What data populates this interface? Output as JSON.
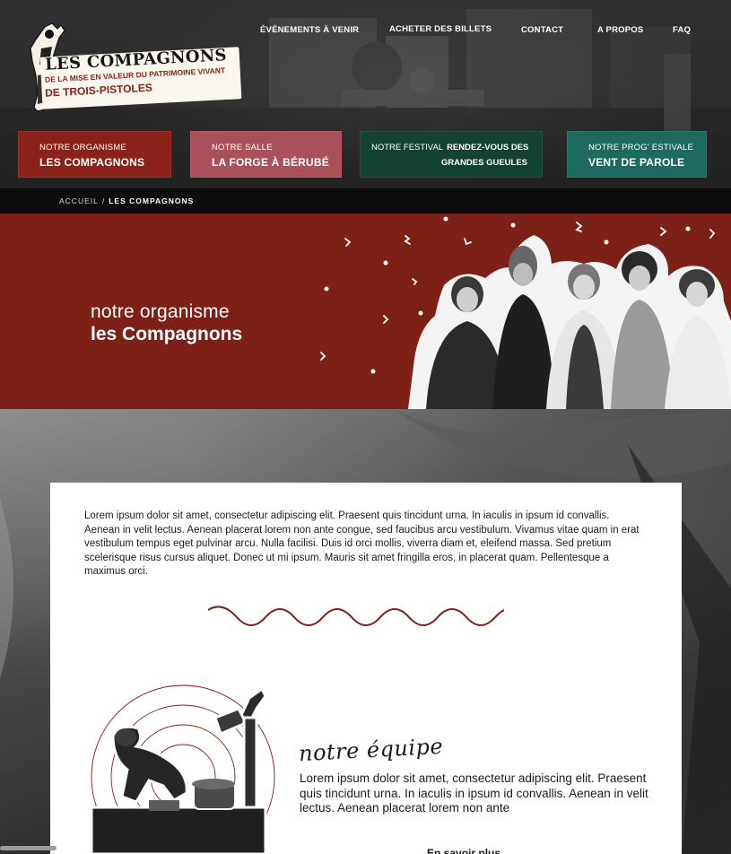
{
  "logo": {
    "line1": "LES COMPAGNONS",
    "line2": "DE LA MISE EN VALEUR DU PATRIMOINE VIVANT",
    "line3": "DE TROIS-PISTOLES"
  },
  "nav": [
    {
      "label": "ÉVÉNEMENTS À VENIR"
    },
    {
      "label": "ACHETER DES BILLETS"
    },
    {
      "label": "CONTACT"
    },
    {
      "label": "A PROPOS"
    },
    {
      "label": "FAQ"
    }
  ],
  "tiles": [
    {
      "small": "NOTRE ORGANISME",
      "big": "LES COMPAGNONS",
      "color": "#8b2219"
    },
    {
      "small": "NOTRE SALLE",
      "big": "LA FORGE À BÉRUBÉ",
      "color": "#a9505a"
    },
    {
      "small": "NOTRE FESTIVAL",
      "big": "RENDEZ-VOUS DES",
      "big2": "GRANDES GUEULES",
      "color": "#134133"
    },
    {
      "small": "NOTRE PROG' ESTIVALE",
      "big": "VENT DE PAROLE",
      "color": "#1d6b5e"
    }
  ],
  "breadcrumb": {
    "home": "ACCUEIL",
    "separator": "/",
    "current": "LES COMPAGNONS"
  },
  "hero": {
    "subtitle": "notre organisme",
    "title": "les Compagnons",
    "background": "#7d2016"
  },
  "content": {
    "intro": "Lorem ipsum dolor sit amet, consectetur adipiscing elit. Praesent quis tincidunt urna. In iaculis in ipsum id convallis. Aenean in velit lectus. Aenean placerat lorem non ante congue, sed faucibus arcu vestibulum. Vivamus vitae quam in erat vestibulum tempus eget pulvinar arcu. Nulla facilisi. Duis id orci mollis, viverra diam et, eleifend massa. Sed pretium scelerisque risus cursus aliquet. Donec ut mi ipsum. Mauris sit amet fringilla eros, in placerat quam. Pellentesque a maximus orci.",
    "team_heading": "notre équipe",
    "team_text": "Lorem ipsum dolor sit amet, consectetur adipiscing elit. Praesent quis tincidunt urna. In iaculis in ipsum id convallis. Aenean in velit lectus. Aenean placerat lorem non ante",
    "more_link": "En savoir plus"
  },
  "colors": {
    "accent_red": "#7d2016",
    "wave": "#7d2016"
  }
}
